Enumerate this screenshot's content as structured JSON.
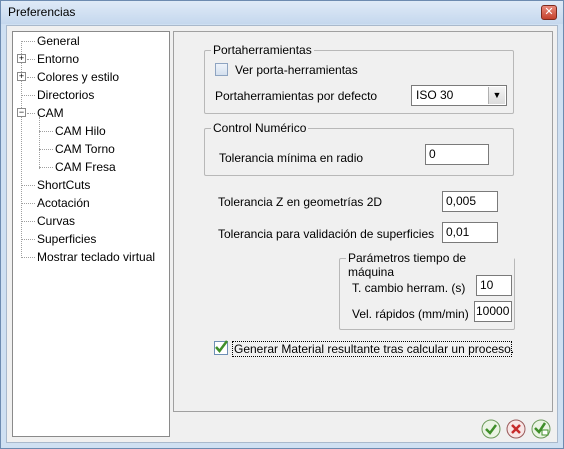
{
  "window": {
    "title": "Preferencias",
    "close_glyph": "✕"
  },
  "tree": {
    "items": [
      {
        "label": "General"
      },
      {
        "label": "Entorno",
        "expander": "+"
      },
      {
        "label": "Colores y estilo",
        "expander": "+"
      },
      {
        "label": "Directorios"
      },
      {
        "label": "CAM",
        "expander": "−"
      },
      {
        "label": "CAM Hilo"
      },
      {
        "label": "CAM Torno"
      },
      {
        "label": "CAM Fresa"
      },
      {
        "label": "ShortCuts"
      },
      {
        "label": "Acotación"
      },
      {
        "label": "Curvas"
      },
      {
        "label": "Superficies"
      },
      {
        "label": "Mostrar teclado virtual"
      }
    ]
  },
  "portaherramientas": {
    "title": "Portaherramientas",
    "ver_label": "Ver porta-herramientas",
    "ver_checked": false,
    "defecto_label": "Portaherramientas por defecto",
    "defecto_value": "ISO 30"
  },
  "control_numerico": {
    "title": "Control Numérico",
    "tolerancia_radio_label": "Tolerancia mínima en radio",
    "tolerancia_radio_value": "0"
  },
  "tolerancias": {
    "z_label": "Tolerancia Z en geometrías 2D",
    "z_value": "0,005",
    "superficies_label": "Tolerancia para validación de superficies",
    "superficies_value": "0,01"
  },
  "tiempo_maquina": {
    "title": "Parámetros tiempo de máquina",
    "cambio_label": "T. cambio herram. (s)",
    "cambio_value": "10",
    "rapidos_label": "Vel. rápidos (mm/min)",
    "rapidos_value": "10000"
  },
  "material": {
    "label": "Generar Material resultante tras calcular un proceso.",
    "checked": true
  },
  "buttons": {
    "ok": "ok-icon",
    "cancel": "cancel-icon",
    "apply": "apply-icon"
  },
  "colors": {
    "accent": "#3f8f2a",
    "cancel": "#c62b2b",
    "frame": "#cfe0f2"
  }
}
